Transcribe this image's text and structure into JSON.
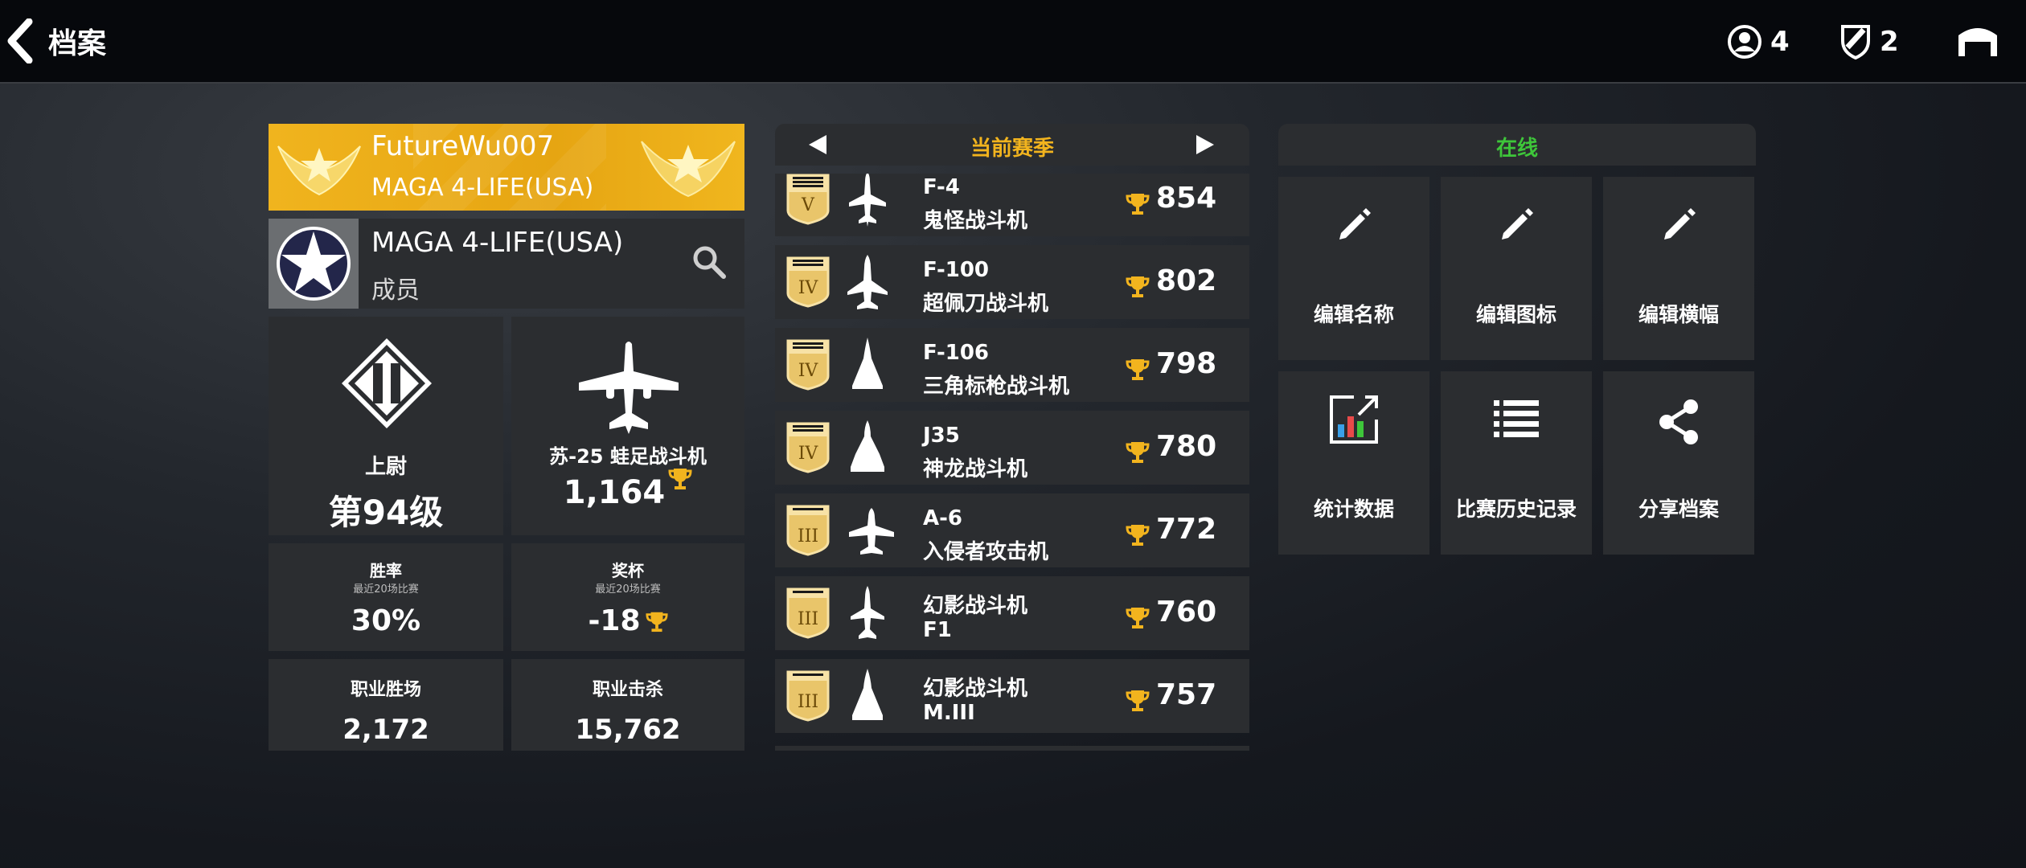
{
  "header": {
    "back_label": "档案",
    "players_count": "4",
    "shields_count": "2"
  },
  "profile": {
    "player_name": "FutureWu007",
    "clan_tag": "MAGA 4-LIFE(USA)"
  },
  "clan": {
    "name": "MAGA 4-LIFE(USA)",
    "role": "成员"
  },
  "rank": {
    "title": "上尉",
    "level": "第94级"
  },
  "favorite_plane": {
    "name": "苏-25 蛙足战斗机",
    "trophies": "1,164"
  },
  "stats": {
    "win_rate": {
      "label": "胜率",
      "sub": "最近20场比赛",
      "value": "30%"
    },
    "trophies": {
      "label": "奖杯",
      "sub": "最近20场比赛",
      "value": "-18"
    },
    "career_wins": {
      "label": "职业胜场",
      "value": "2,172"
    },
    "career_kills": {
      "label": "职业击杀",
      "value": "15,762"
    }
  },
  "season": {
    "title": "当前赛季"
  },
  "planes": [
    {
      "tier": "V",
      "line1": "F-4",
      "line2": "鬼怪战斗机",
      "score": "854"
    },
    {
      "tier": "IV",
      "line1": "F-100",
      "line2": "超佩刀战斗机",
      "score": "802"
    },
    {
      "tier": "IV",
      "line1": "F-106",
      "line2": "三角标枪战斗机",
      "score": "798"
    },
    {
      "tier": "IV",
      "line1": "J35",
      "line2": "神龙战斗机",
      "score": "780"
    },
    {
      "tier": "III",
      "line1": "A-6",
      "line2": "入侵者攻击机",
      "score": "772"
    },
    {
      "tier": "III",
      "line1": "幻影战斗机",
      "line2": "F1",
      "score": "760"
    },
    {
      "tier": "III",
      "line1": "幻影战斗机",
      "line2": "M.III",
      "score": "757"
    }
  ],
  "status": {
    "online": "在线"
  },
  "actions": {
    "edit_name": "编辑名称",
    "edit_icon": "编辑图标",
    "edit_banner": "编辑横幅",
    "statistics": "统计数据",
    "match_history": "比赛历史记录",
    "share_profile": "分享档案"
  },
  "colors": {
    "gold": "#f2b41e",
    "online_green": "#3ec63a",
    "panel": "#2b2d30"
  }
}
